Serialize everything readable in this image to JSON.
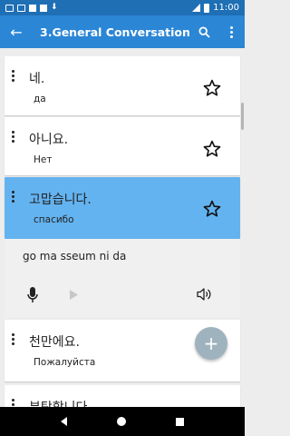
{
  "status_bar": {
    "time": "11:00"
  },
  "app_bar": {
    "title": "3.General Conversation"
  },
  "items": [
    {
      "korean": "네.",
      "russian": "да",
      "selected": false
    },
    {
      "korean": "아니요.",
      "russian": "Нет",
      "selected": false
    },
    {
      "korean": "고맙습니다.",
      "russian": "спасибо",
      "selected": true
    },
    {
      "korean": "천만에요.",
      "russian": "Пожалуйста",
      "selected": false
    },
    {
      "korean": "부탁합니다.",
      "russian": "",
      "selected": false
    }
  ],
  "expanded": {
    "romanization": "go ma sseum ni da"
  },
  "fab": {
    "symbol": "+"
  },
  "colors": {
    "status_bar": "#1f6fb5",
    "app_bar": "#2b86d6",
    "selected_card": "#63b3f0",
    "fab": "#9fb3bf"
  }
}
